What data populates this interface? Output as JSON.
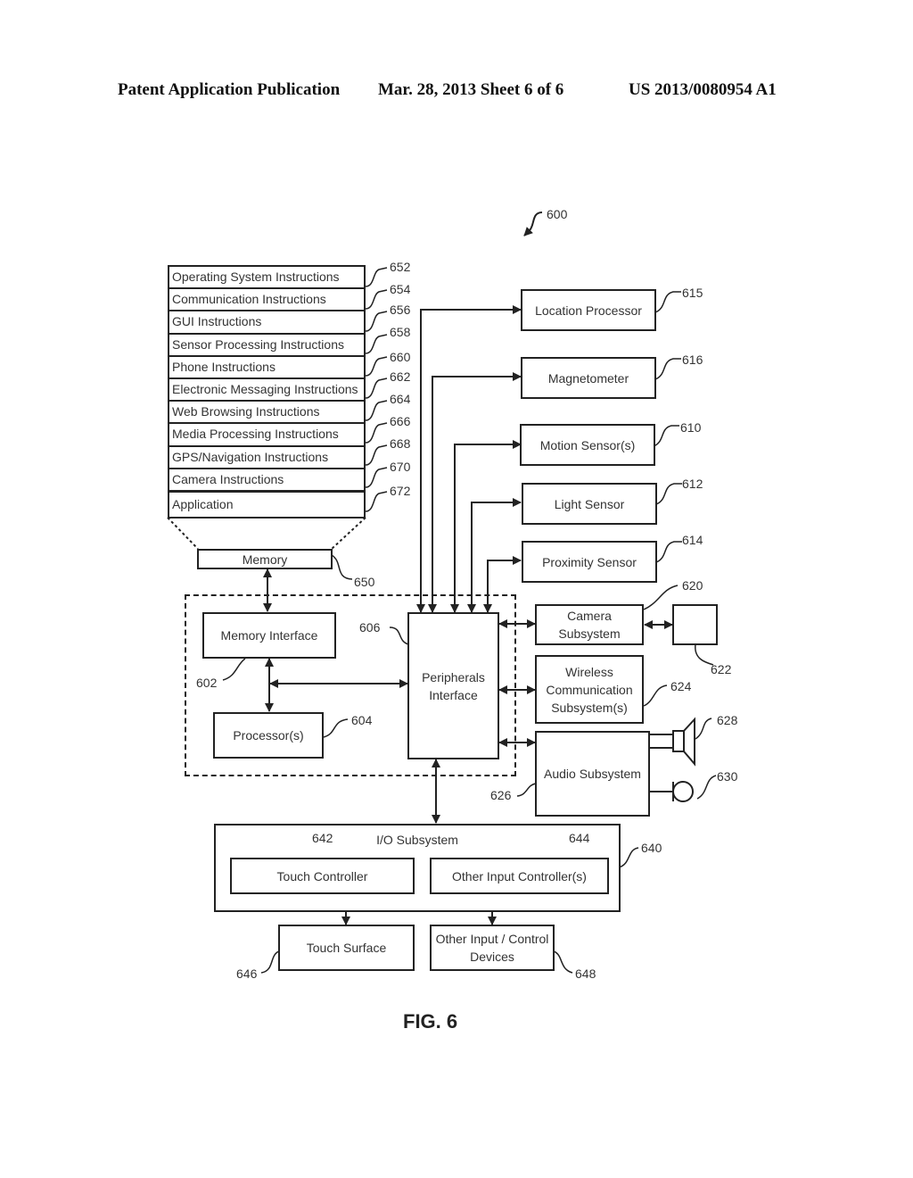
{
  "header": {
    "left": "Patent Application Publication",
    "middle": "Mar. 28, 2013  Sheet 6 of 6",
    "right": "US 2013/0080954 A1"
  },
  "figure": {
    "ref": "600",
    "caption": "FIG. 6"
  },
  "memory_stack": {
    "items": [
      {
        "label": "Operating System Instructions",
        "ref": "652"
      },
      {
        "label": "Communication Instructions",
        "ref": "654"
      },
      {
        "label": "GUI Instructions",
        "ref": "656"
      },
      {
        "label": "Sensor Processing Instructions",
        "ref": "658"
      },
      {
        "label": "Phone Instructions",
        "ref": "660"
      },
      {
        "label": "Electronic Messaging Instructions",
        "ref": "662"
      },
      {
        "label": "Web Browsing Instructions",
        "ref": "664"
      },
      {
        "label": "Media Processing Instructions",
        "ref": "666"
      },
      {
        "label": "GPS/Navigation Instructions",
        "ref": "668"
      },
      {
        "label": "Camera Instructions",
        "ref": "670"
      },
      {
        "label": "Application",
        "ref": "672"
      }
    ]
  },
  "blocks": {
    "memory": {
      "label": "Memory",
      "ref": "650"
    },
    "memory_interface": {
      "label": "Memory Interface",
      "ref": "602"
    },
    "processors": {
      "label": "Processor(s)",
      "ref": "604"
    },
    "peripherals_interface": {
      "label": "Peripherals Interface",
      "ref": "606"
    },
    "location_processor": {
      "label": "Location Processor",
      "ref": "615"
    },
    "magnetometer": {
      "label": "Magnetometer",
      "ref": "616"
    },
    "motion_sensor": {
      "label": "Motion Sensor(s)",
      "ref": "610"
    },
    "light_sensor": {
      "label": "Light Sensor",
      "ref": "612"
    },
    "proximity_sensor": {
      "label": "Proximity Sensor",
      "ref": "614"
    },
    "camera_subsystem": {
      "label": "Camera Subsystem",
      "ref": "620"
    },
    "optical_sensor": {
      "label": "",
      "ref": "622"
    },
    "wireless_subsystem": {
      "label": "Wireless Communication Subsystem(s)",
      "ref": "624"
    },
    "audio_subsystem": {
      "label": "Audio Subsystem",
      "ref": "626"
    },
    "speaker": {
      "ref": "628"
    },
    "microphone": {
      "ref": "630"
    },
    "io_subsystem": {
      "label": "I/O Subsystem",
      "ref": "640"
    },
    "touch_controller": {
      "label": "Touch Controller",
      "ref": "642"
    },
    "other_input_controllers": {
      "label": "Other Input Controller(s)",
      "ref": "644"
    },
    "touch_surface": {
      "label": "Touch Surface",
      "ref": "646"
    },
    "other_input_devices": {
      "label": "Other Input / Control Devices",
      "ref": "648"
    }
  }
}
